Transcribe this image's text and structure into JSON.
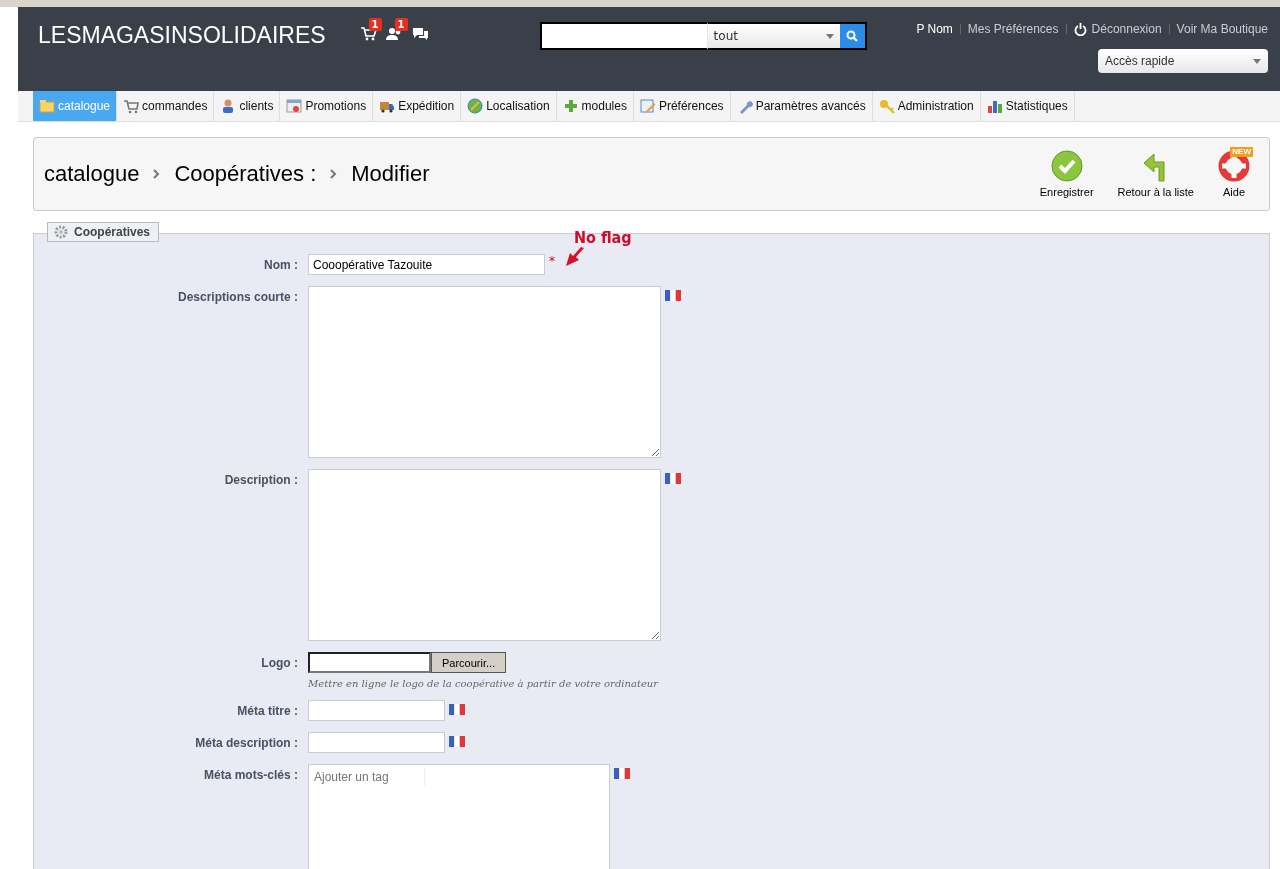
{
  "header": {
    "shop_name": "LESMAGASINSOLIDAIRES",
    "notifications": [
      {
        "kind": "cart",
        "count": "1"
      },
      {
        "kind": "customers",
        "count": "1"
      },
      {
        "kind": "messages"
      }
    ],
    "search": {
      "scope": "tout"
    },
    "user_links": [
      {
        "kind": "user",
        "label": "P Nom"
      },
      {
        "kind": "link",
        "label": "Mes Préférences"
      },
      {
        "kind": "logout",
        "label": "Déconnexion"
      },
      {
        "kind": "link",
        "label": "Voir Ma Boutique"
      }
    ],
    "quick_access": "Accès rapide"
  },
  "tabs": [
    {
      "label": "catalogue",
      "selected": true
    },
    {
      "label": "commandes",
      "selected": false
    },
    {
      "label": "clients",
      "selected": false
    },
    {
      "label": "Promotions",
      "selected": false
    },
    {
      "label": "Expédition",
      "selected": false
    },
    {
      "label": "Localisation",
      "selected": false
    },
    {
      "label": "modules",
      "selected": false
    },
    {
      "label": "Préférences",
      "selected": false
    },
    {
      "label": "Paramètres avancés",
      "selected": false
    },
    {
      "label": "Administration",
      "selected": false
    },
    {
      "label": "Statistiques",
      "selected": false
    }
  ],
  "breadcrumb": [
    "catalogue",
    "Coopératives :",
    "Modifier"
  ],
  "toolbar": [
    {
      "kind": "save",
      "label": "Enregistrer"
    },
    {
      "kind": "back",
      "label": "Retour à la liste"
    },
    {
      "kind": "help",
      "label": "Aide",
      "badge": "NEW"
    }
  ],
  "form": {
    "legend": "Coopératives",
    "annotation": "No flag",
    "fields": [
      {
        "kind": "text",
        "label": "Nom :",
        "value": "Cooopérative Tazouite",
        "required_mark": "*",
        "flag": false
      },
      {
        "kind": "textarea",
        "label": "Descriptions courte :",
        "flag": true
      },
      {
        "kind": "textarea",
        "label": "Description :",
        "flag": true
      },
      {
        "kind": "file",
        "label": "Logo :",
        "button": "Parcourir...",
        "hint": "Mettre en ligne le logo de la coopérative à partir de votre ordinateur",
        "flag": false
      },
      {
        "kind": "short",
        "label": "Méta titre :",
        "flag": true
      },
      {
        "kind": "short",
        "label": "Méta description :",
        "flag": true
      },
      {
        "kind": "tags",
        "label": "Méta mots-clés :",
        "placeholder": "Ajouter un tag",
        "flag": true
      }
    ]
  }
}
